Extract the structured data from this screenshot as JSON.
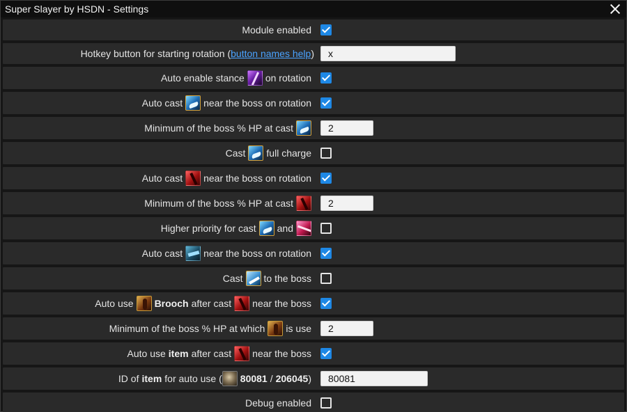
{
  "window": {
    "title": "Super Slayer by HSDN - Settings"
  },
  "rows": {
    "r1": {
      "label": "Module enabled",
      "checked": true
    },
    "r2": {
      "pre": "Hotkey button for starting rotation (",
      "link": "button names help",
      "post": ")",
      "value": "x"
    },
    "r3": {
      "pre": "Auto enable stance",
      "icon": "stance-icon",
      "post": "on rotation",
      "checked": true
    },
    "r4": {
      "pre": "Auto cast",
      "icon": "blue-skill-icon",
      "post": "near the boss on rotation",
      "checked": true
    },
    "r5": {
      "pre": "Minimum of the boss % HP at cast",
      "icon": "blue-skill-icon",
      "value": "2"
    },
    "r6": {
      "pre": "Cast",
      "icon": "blue-skill-icon",
      "post": "full charge",
      "checked": false
    },
    "r7": {
      "pre": "Auto cast",
      "icon": "red-skill-icon",
      "post": "near the boss on rotation",
      "checked": true
    },
    "r8": {
      "pre": "Minimum of the boss % HP at cast",
      "icon": "red-skill-icon",
      "value": "2"
    },
    "r9": {
      "pre": "Higher priority for cast",
      "icon": "blue-skill-icon",
      "mid": "and",
      "icon2": "pink-skill-icon",
      "checked": false
    },
    "r10": {
      "pre": "Auto cast",
      "icon": "teal-skill-icon",
      "post": "near the boss on rotation",
      "checked": true
    },
    "r11": {
      "pre": "Cast",
      "icon": "sky-skill-icon",
      "post": "to the boss",
      "checked": false
    },
    "r12": {
      "pre": "Auto use",
      "icon": "brooch-icon",
      "bold": "Brooch",
      "mid": "after cast",
      "icon2": "red-skill-icon",
      "post": "near the boss",
      "checked": true
    },
    "r13": {
      "pre": "Minimum of the boss % HP at which",
      "icon": "brooch-icon",
      "post": "is use",
      "value": "2"
    },
    "r14": {
      "pre": "Auto use",
      "bold": "item",
      "mid": "after cast",
      "icon": "red-skill-icon",
      "post": "near the boss",
      "checked": true
    },
    "r15": {
      "pre": "ID of",
      "bold": "item",
      "mid": "for auto use (",
      "icon": "item-icon",
      "id1": "80081",
      "sep": "/",
      "id2": "206045",
      "post": ")",
      "value": "80081"
    },
    "r16": {
      "label": "Debug enabled",
      "checked": false
    }
  },
  "colors": {
    "accent": "#1e88e5",
    "link": "#4aa3ff",
    "row_bg": "#2a2a2a",
    "window_bg": "#161616"
  }
}
